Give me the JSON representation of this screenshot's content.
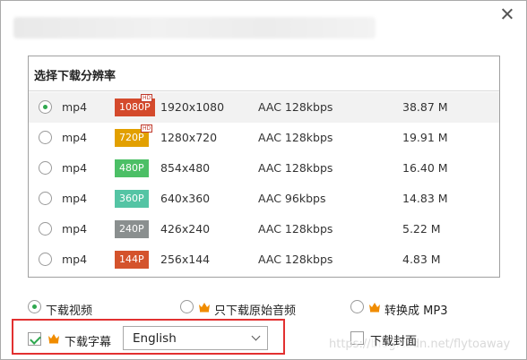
{
  "panel": {
    "title": "选择下载分辨率"
  },
  "rows": [
    {
      "format": "mp4",
      "badge": "1080P",
      "badge_color": "#d44a2c",
      "hd": "HD",
      "resolution": "1920x1080",
      "audio": "AAC 128kbps",
      "size": "38.87 M",
      "selected": true
    },
    {
      "format": "mp4",
      "badge": "720P",
      "badge_color": "#e2a000",
      "hd": "HD",
      "resolution": "1280x720",
      "audio": "AAC 128kbps",
      "size": "19.91 M",
      "selected": false
    },
    {
      "format": "mp4",
      "badge": "480P",
      "badge_color": "#4cbf66",
      "resolution": "854x480",
      "audio": "AAC 128kbps",
      "size": "16.40 M",
      "selected": false
    },
    {
      "format": "mp4",
      "badge": "360P",
      "badge_color": "#54c4a4",
      "resolution": "640x360",
      "audio": "AAC 96kbps",
      "size": "14.83 M",
      "selected": false
    },
    {
      "format": "mp4",
      "badge": "240P",
      "badge_color": "#8a8f8f",
      "resolution": "426x240",
      "audio": "AAC 128kbps",
      "size": "5.22 M",
      "selected": false
    },
    {
      "format": "mp4",
      "badge": "144P",
      "badge_color": "#d4532c",
      "resolution": "256x144",
      "audio": "AAC 128kbps",
      "size": "4.83 M",
      "selected": false
    }
  ],
  "options": {
    "video": {
      "label": "下载视频",
      "selected": true
    },
    "audio": {
      "label": "只下载原始音频",
      "selected": false
    },
    "mp3": {
      "label": "转换成 MP3",
      "selected": false
    }
  },
  "subtitle": {
    "label": "下载字幕",
    "checked": true,
    "language": "English"
  },
  "cover": {
    "label": "下载封面",
    "checked": false
  },
  "watermark": "https://blog.csdn.net/flytoaway",
  "colors": {
    "accent_green": "#2fa84f",
    "crown": "#f08c00",
    "highlight_border": "#e23030"
  }
}
